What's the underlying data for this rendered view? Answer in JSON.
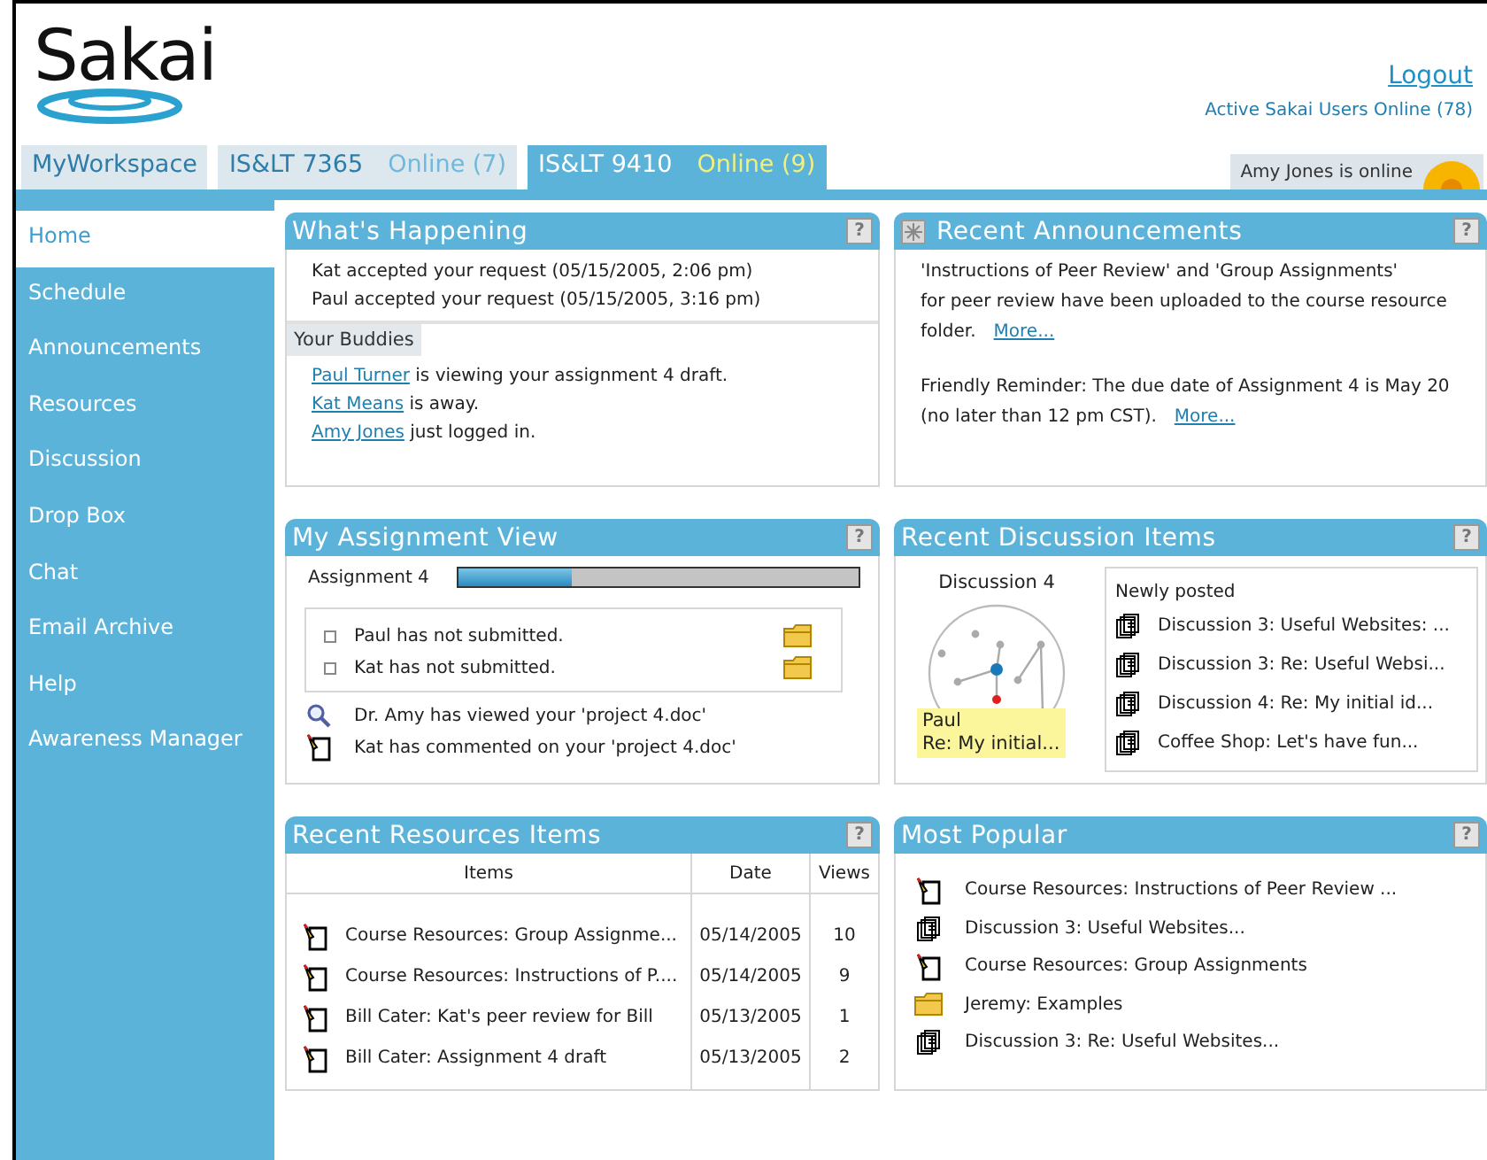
{
  "header": {
    "logo": "Sakai",
    "logout": "Logout",
    "active_users": "Active Sakai Users Online (78)"
  },
  "tabs": [
    {
      "label": "MyWorkspace",
      "selected": false
    },
    {
      "label": "IS&LT 7365",
      "online": "Online (7)",
      "selected": false
    },
    {
      "label": "IS&LT 9410",
      "online": "Online (9)",
      "selected": true
    }
  ],
  "presence": "Amy Jones is online",
  "sidebar": {
    "items": [
      {
        "label": "Home",
        "selected": true
      },
      {
        "label": "Schedule",
        "selected": false
      },
      {
        "label": "Announcements",
        "selected": false
      },
      {
        "label": "Resources",
        "selected": false
      },
      {
        "label": "Discussion",
        "selected": false
      },
      {
        "label": "Drop Box",
        "selected": false
      },
      {
        "label": "Chat",
        "selected": false
      },
      {
        "label": "Email Archive",
        "selected": false
      },
      {
        "label": "Help",
        "selected": false
      },
      {
        "label": "Awareness Manager",
        "selected": false
      }
    ]
  },
  "whats_happening": {
    "title": "What's Happening",
    "help": "?",
    "requests": [
      "Kat accepted your request  (05/15/2005, 2:06 pm)",
      "Paul accepted your request (05/15/2005, 3:16 pm)"
    ],
    "buddies_heading": "Your Buddies",
    "buddies": [
      {
        "name": "Paul Turner",
        "text": "is viewing your assignment 4 draft."
      },
      {
        "name": "Kat Means",
        "text": " is away."
      },
      {
        "name": "Amy Jones",
        "text": "just logged in."
      }
    ]
  },
  "announcements": {
    "title": "Recent Announcements",
    "help": "?",
    "items": [
      {
        "lines": [
          " 'Instructions of Peer Review' and 'Group Assignments'",
          "for peer review have been uploaded to the course resource",
          "folder."
        ],
        "more": "More..."
      },
      {
        "lines": [
          "Friendly Reminder: The due date of Assignment 4 is May 20",
          "(no later than 12 pm CST)."
        ],
        "more": "More..."
      }
    ]
  },
  "assignment_view": {
    "title": "My Assignment View",
    "help": "?",
    "assignment": {
      "label": "Assignment 4",
      "level": 0.28
    },
    "submissions": [
      "Paul has not submitted.",
      "Kat has not submitted."
    ],
    "activity": [
      {
        "kind": "view",
        "text": "Dr. Amy has viewed your 'project 4.doc'"
      },
      {
        "kind": "comment",
        "text": "Kat has commented on your 'project 4.doc'"
      }
    ]
  },
  "discussion": {
    "title": "Recent Discussion Items",
    "help": "?",
    "graph_label": "Discussion 4",
    "tooltip": [
      "Paul",
      "Re: My initial..."
    ],
    "newly_posted": "Newly posted",
    "items": [
      "Discussion 3: Useful Websites: ...",
      "Discussion 3: Re: Useful Websi...",
      "Discussion 4: Re: My initial id...",
      "Coffee Shop: Let's have fun..."
    ]
  },
  "resources": {
    "title": "Recent Resources Items",
    "help": "?",
    "columns": [
      "Items",
      "Date",
      "Views"
    ],
    "rows": [
      [
        "Course Resources: Group Assignme...",
        "05/14/2005",
        "10"
      ],
      [
        "Course Resources: Instructions of P....",
        "05/14/2005",
        "9"
      ],
      [
        "Bill Cater: Kat's peer review for Bill",
        "05/13/2005",
        "1"
      ],
      [
        "Bill Cater: Assignment 4 draft",
        "05/13/2005",
        "2"
      ]
    ]
  },
  "popular": {
    "title": "Most Popular",
    "help": "?",
    "items": [
      {
        "kind": "comment",
        "text": "Course Resources: Instructions of Peer Review ..."
      },
      {
        "kind": "discussion",
        "text": "Discussion 3: Useful Websites..."
      },
      {
        "kind": "comment",
        "text": "Course Resources: Group Assignments"
      },
      {
        "kind": "folder",
        "text": "Jeremy: Examples"
      },
      {
        "kind": "discussion",
        "text": "Discussion 3: Re: Useful Websites..."
      }
    ]
  }
}
